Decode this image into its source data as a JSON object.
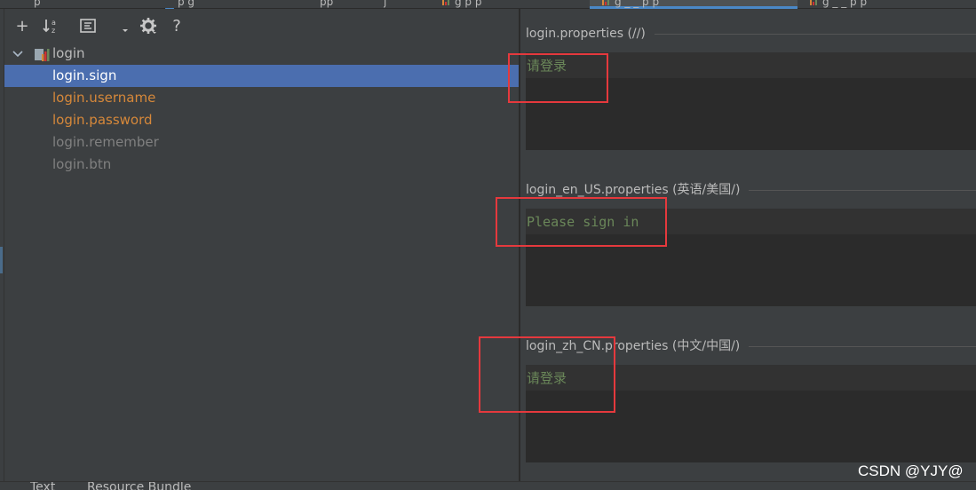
{
  "top_tabs": {
    "fragments": [
      "p",
      "p g",
      "pp",
      "j",
      "g p p",
      "g _ _ p p",
      "g _ _ p p"
    ]
  },
  "toolbar": {
    "add_label": "+",
    "help_label": "?"
  },
  "tree": {
    "root_label": "login",
    "items": [
      {
        "label": "login.sign"
      },
      {
        "label": "login.username"
      },
      {
        "label": "login.password"
      },
      {
        "label": "login.remember"
      },
      {
        "label": "login.btn"
      }
    ]
  },
  "sections": [
    {
      "title": "login.properties (//)",
      "value": "请登录"
    },
    {
      "title": "login_en_US.properties (英语/美国/)",
      "value": "Please sign in"
    },
    {
      "title": "login_zh_CN.properties (中文/中国/)",
      "value": "请登录"
    }
  ],
  "bottom_tabs": [
    "Text",
    "Resource Bundle"
  ],
  "watermark": "CSDN @YJY@",
  "colors": {
    "selection": "#4b6eaf",
    "modified_key": "#d6883a",
    "unused_key": "#808080",
    "value_text": "#6a8759",
    "annotation": "#e5393d"
  }
}
